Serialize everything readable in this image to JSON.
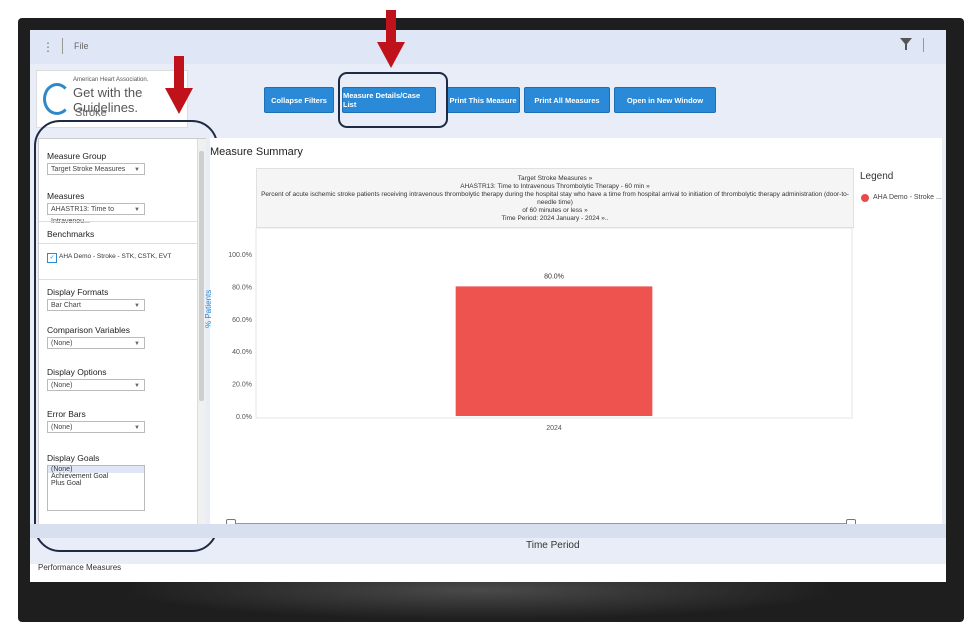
{
  "topbar": {
    "menu_label": "File"
  },
  "logo": {
    "org": "American Heart Association.",
    "name": "Get with the Guidelines.",
    "sub": "Stroke"
  },
  "toolbar": {
    "collapse_filters": "Collapse Filters",
    "measure_details": "Measure Details/Case List",
    "print_this": "Print This Measure",
    "print_all": "Print All Measures",
    "open_new": "Open in New Window"
  },
  "sidebar": {
    "measure_group_label": "Measure Group",
    "measure_group_value": "Target Stroke Measures",
    "measures_label": "Measures",
    "measures_value": "AHASTR13: Time to Intravenou...",
    "benchmarks_label": "Benchmarks",
    "benchmark_item": "AHA Demo - Stroke - STK, CSTK, EVT",
    "display_formats_label": "Display Formats",
    "display_formats_value": "Bar Chart",
    "comparison_label": "Comparison Variables",
    "comparison_value": "(None)",
    "display_options_label": "Display Options",
    "display_options_value": "(None)",
    "error_bars_label": "Error Bars",
    "error_bars_value": "(None)",
    "display_goals_label": "Display Goals",
    "goals": [
      "(None)",
      "Achievement Goal",
      "Plus Goal"
    ]
  },
  "main": {
    "title": "Measure Summary",
    "header_line1": "Target Stroke Measures »",
    "header_line2": "AHASTR13: Time to Intravenous Thrombolytic Therapy - 60 min »",
    "header_line3": "Percent of acute ischemic stroke patients receiving intravenous thrombolytic therapy during the hospital stay who have a time from hospital arrival to initiation of thrombolytic therapy administration (door-to-needle time)",
    "header_line4": "of 60 minutes or less »",
    "header_line5": "Time Period: 2024 January - 2024 »..",
    "yaxis_title": "% Patients",
    "xaxis_title": "Time Period",
    "legend_title": "Legend",
    "legend_item": "AHA Demo - Stroke ..."
  },
  "footer": {
    "tab": "Performance Measures"
  },
  "chart_data": {
    "type": "bar",
    "categories": [
      "2024"
    ],
    "values": [
      80.0
    ],
    "value_labels": [
      "80.0%"
    ],
    "yticks": [
      "0.0%",
      "20.0%",
      "40.0%",
      "60.0%",
      "80.0%",
      "100.0%"
    ],
    "ylim": [
      0,
      100
    ],
    "xlabel": "Time Period",
    "ylabel": "% Patients",
    "bar_color": "#ef5350"
  },
  "colors": {
    "accent": "#2a8ad8",
    "annotation": "#c0121a",
    "outline": "#1f2a44"
  }
}
